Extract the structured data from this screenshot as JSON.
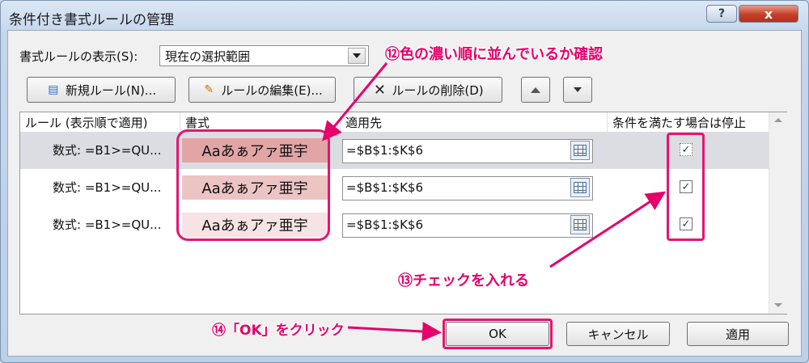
{
  "window": {
    "title": "条件付き書式ルールの管理",
    "help_glyph": "?",
    "close_glyph": "x"
  },
  "show_rules": {
    "label": "書式ルールの表示(S):",
    "value": "現在の選択範囲"
  },
  "toolbar": {
    "new_rule": "新規ルール(N)...",
    "edit_rule": "ルールの編集(E)...",
    "delete_rule": "ルールの削除(D)"
  },
  "table": {
    "headers": {
      "rule": "ルール (表示順で適用)",
      "format": "書式",
      "applies_to": "適用先",
      "stop_if_true": "条件を満たす場合は停止"
    },
    "rows": [
      {
        "rule": "数式: =B1>=QU...",
        "preview": "Aaあぁアァ亜宇",
        "applies_to": "=$B$1:$K$6",
        "stop": "✓",
        "bg": "#e2a5a5"
      },
      {
        "rule": "数式: =B1>=QU...",
        "preview": "Aaあぁアァ亜宇",
        "applies_to": "=$B$1:$K$6",
        "stop": "✓",
        "bg": "#ecc4c4"
      },
      {
        "rule": "数式: =B1>=QU...",
        "preview": "Aaあぁアァ亜宇",
        "applies_to": "=$B$1:$K$6",
        "stop": "✓",
        "bg": "#f7e3e3"
      }
    ]
  },
  "footer": {
    "ok": "OK",
    "cancel": "キャンセル",
    "apply": "適用"
  },
  "annotations": {
    "a12": "⑫色の濃い順に並んでいるか確認",
    "a13": "⑬チェックを入れる",
    "a14": "⑭「OK」をクリック",
    "color": "#e5006a"
  }
}
